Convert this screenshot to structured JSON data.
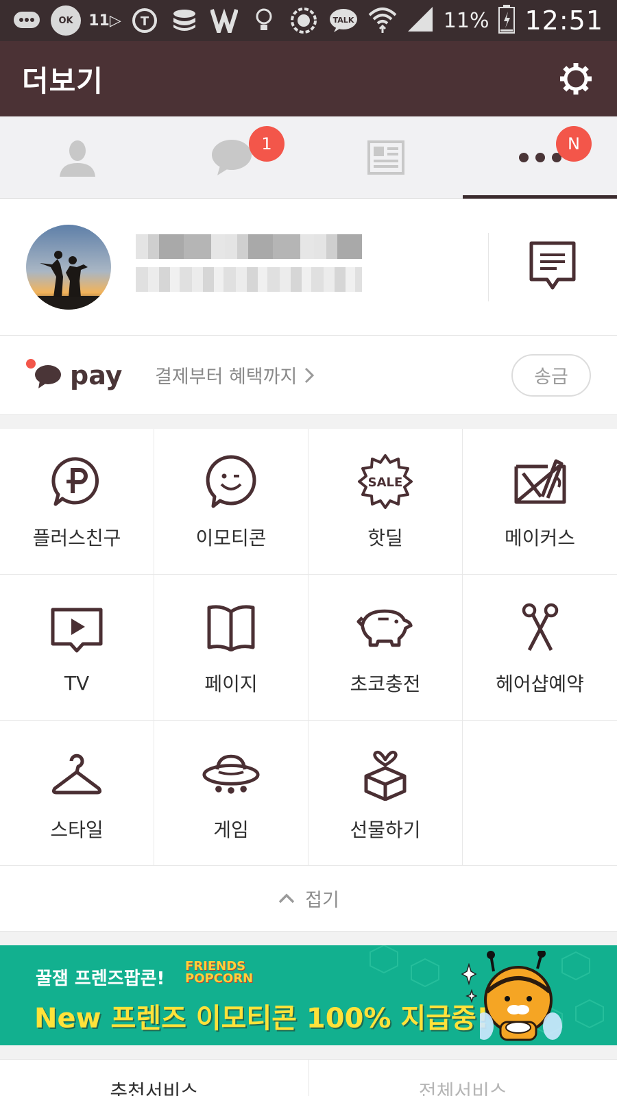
{
  "status_bar": {
    "icons": [
      "message-icon",
      "ok-cashbag-icon",
      "11st-icon",
      "t-icon",
      "db-icon",
      "vpn-icon",
      "bulb-icon",
      "gear-8-icon",
      "kakaotalk-icon",
      "wifi-icon",
      "signal-icon"
    ],
    "ok_label": "OK",
    "eleven_label": "11",
    "talk_label": "TALK",
    "battery": "11%",
    "time": "12:51"
  },
  "header": {
    "title": "더보기"
  },
  "tabs": [
    {
      "name": "friends",
      "icon": "person-icon",
      "badge": ""
    },
    {
      "name": "chats",
      "icon": "chat-bubble-icon",
      "badge": "1"
    },
    {
      "name": "channel",
      "icon": "news-icon",
      "badge": ""
    },
    {
      "name": "more",
      "icon": "more-dots-icon",
      "badge": "N"
    }
  ],
  "pay": {
    "brand": "pay",
    "description": "결제부터 혜택까지",
    "send_button": "송금"
  },
  "grid": [
    {
      "label": "플러스친구",
      "icon": "plus-friend-icon"
    },
    {
      "label": "이모티콘",
      "icon": "emoticon-icon"
    },
    {
      "label": "핫딜",
      "icon": "sale-icon"
    },
    {
      "label": "메이커스",
      "icon": "makers-icon"
    },
    {
      "label": "TV",
      "icon": "tv-icon"
    },
    {
      "label": "페이지",
      "icon": "book-icon"
    },
    {
      "label": "초코충전",
      "icon": "piggy-bank-icon"
    },
    {
      "label": "헤어샵예약",
      "icon": "scissors-icon"
    },
    {
      "label": "스타일",
      "icon": "hanger-icon"
    },
    {
      "label": "게임",
      "icon": "ufo-icon"
    },
    {
      "label": "선물하기",
      "icon": "gift-icon"
    },
    {
      "label": "",
      "icon": ""
    }
  ],
  "sale_icon_text": "SALE",
  "collapse": {
    "label": "접기"
  },
  "banner": {
    "line1": "꿀잼 프렌즈팝콘!",
    "tag_line1": "FRIENDS",
    "tag_line2": "POPCORN",
    "line2": "New 프렌즈 이모티콘 100% 지급중!",
    "colors": {
      "background": "#12b08f",
      "headline": "#ffe23a"
    }
  },
  "bottom_tabs": [
    "추천서비스",
    "전체서비스"
  ],
  "colors": {
    "header": "#4b3235",
    "status_bar": "#3a2d2f",
    "badge": "#f3564a",
    "icon_brown": "#4a2f33"
  }
}
